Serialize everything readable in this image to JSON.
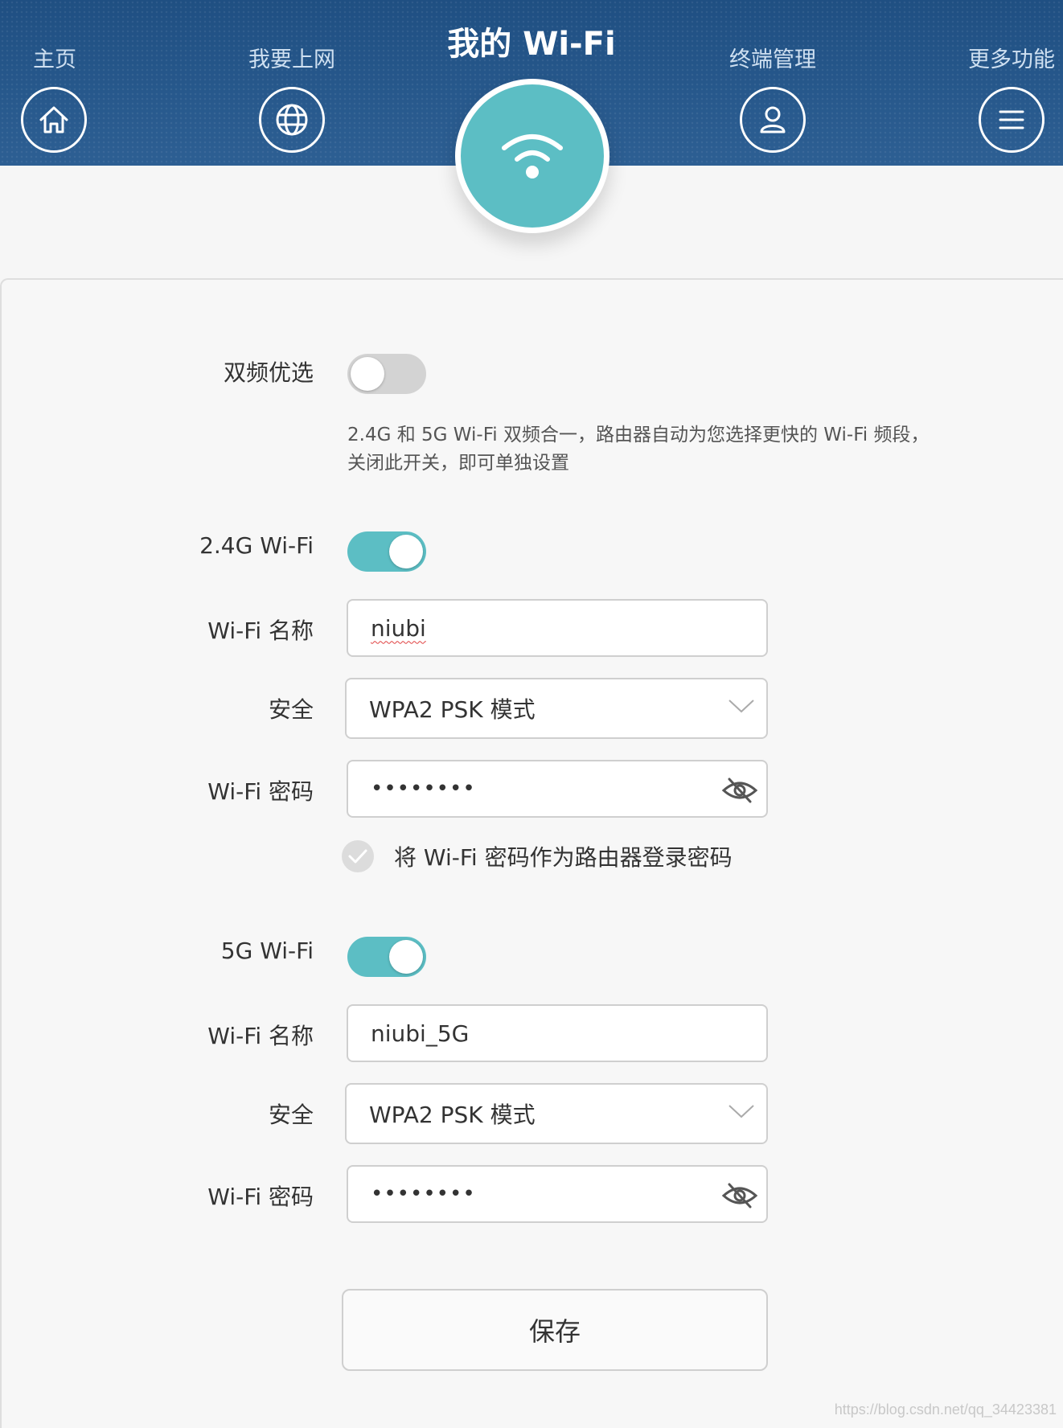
{
  "header": {
    "title": "我的 Wi-Fi",
    "nav": [
      {
        "label": "主页",
        "icon": "home-icon"
      },
      {
        "label": "我要上网",
        "icon": "globe-icon"
      },
      {
        "label": "终端管理",
        "icon": "user-icon"
      },
      {
        "label": "更多功能",
        "icon": "menu-icon"
      }
    ],
    "active_icon": "wifi-icon"
  },
  "dual_band": {
    "label": "双频优选",
    "enabled": false,
    "description_line1": "2.4G 和 5G Wi-Fi 双频合一，路由器自动为您选择更快的 Wi-Fi 频段，",
    "description_line2": "关闭此开关，即可单独设置"
  },
  "band_24": {
    "label": "2.4G Wi-Fi",
    "enabled": true,
    "name_label": "Wi-Fi 名称",
    "name_value": "niubi",
    "security_label": "安全",
    "security_value": "WPA2 PSK 模式",
    "password_label": "Wi-Fi 密码",
    "password_value": "••••••••",
    "use_as_login_label": "将 Wi-Fi 密码作为路由器登录密码",
    "use_as_login_checked": true
  },
  "band_5": {
    "label": "5G Wi-Fi",
    "enabled": true,
    "name_label": "Wi-Fi 名称",
    "name_value": "niubi_5G",
    "security_label": "安全",
    "security_value": "WPA2 PSK 模式",
    "password_label": "Wi-Fi 密码",
    "password_value": "••••••••"
  },
  "save_label": "保存",
  "watermark": "https://blog.csdn.net/qq_34423381",
  "colors": {
    "header_bg": "#2a5a8e",
    "accent": "#5cbec4",
    "toggle_off": "#d3d3d3"
  }
}
